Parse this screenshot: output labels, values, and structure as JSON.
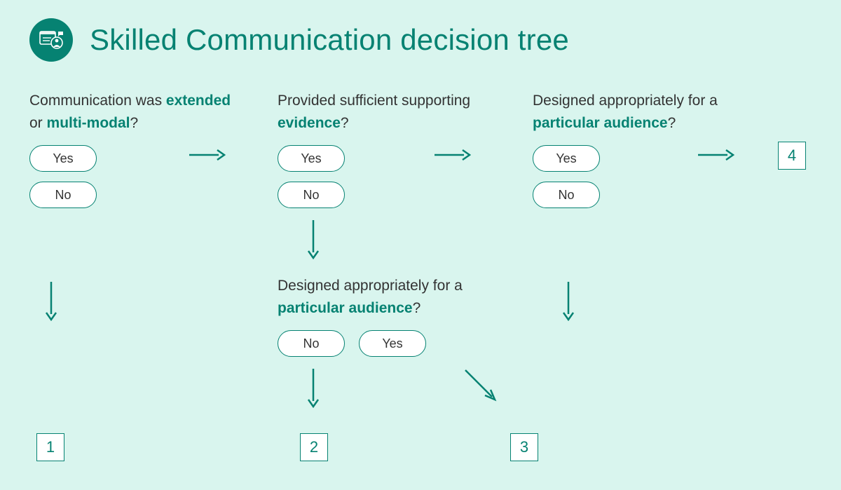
{
  "title": "Skilled Communication decision tree",
  "questions": {
    "q1": {
      "text_pre": "Communication was ",
      "kw1": "extended",
      "mid": " or ",
      "kw2": "multi-modal",
      "suffix": "?"
    },
    "q2": {
      "text_pre": "Provided sufficient supporting ",
      "kw1": "evidence",
      "suffix": "?"
    },
    "q3": {
      "text_pre": "Designed appropriately for a ",
      "kw1": "particular audience",
      "suffix": "?"
    },
    "q4": {
      "text_pre": "Designed appropriately for a ",
      "kw1": "particular audience",
      "suffix": "?"
    }
  },
  "labels": {
    "yes": "Yes",
    "no": "No"
  },
  "results": {
    "r1": "1",
    "r2": "2",
    "r3": "3",
    "r4": "4"
  }
}
